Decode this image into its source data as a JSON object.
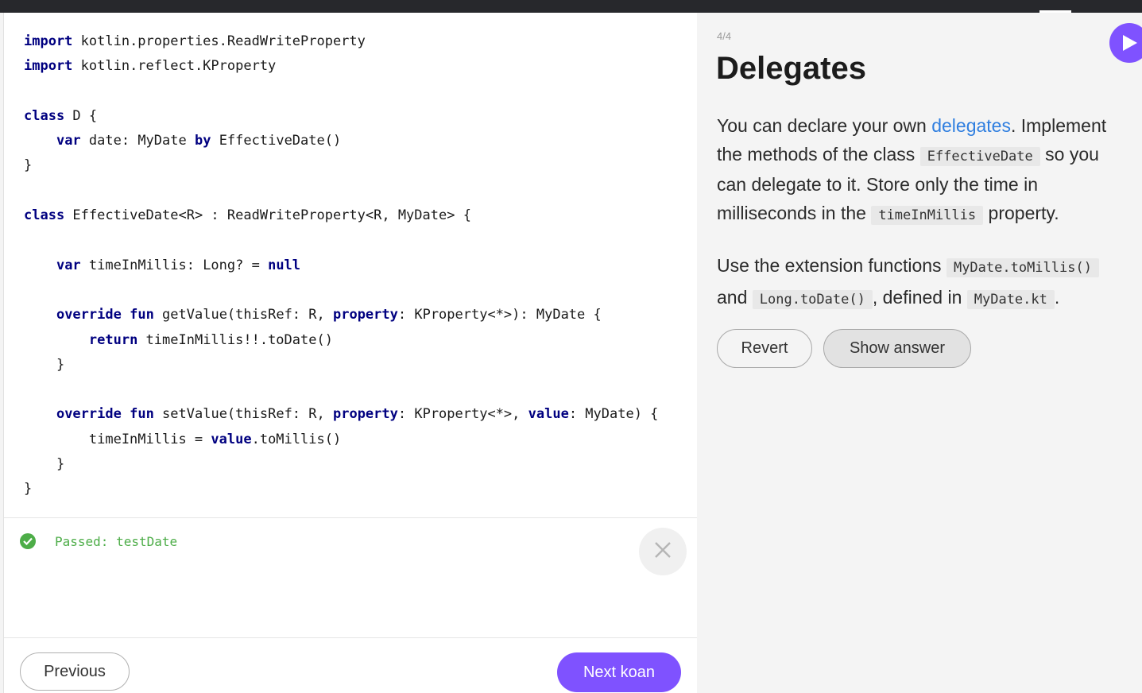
{
  "editor": {
    "code_lines": [
      [
        {
          "t": "import",
          "k": true
        },
        {
          "t": " kotlin.properties.ReadWriteProperty"
        }
      ],
      [
        {
          "t": "import",
          "k": true
        },
        {
          "t": " kotlin.reflect.KProperty"
        }
      ],
      [],
      [
        {
          "t": "class",
          "k": true
        },
        {
          "t": " D {"
        }
      ],
      [
        {
          "t": "    "
        },
        {
          "t": "var",
          "k": true
        },
        {
          "t": " date: MyDate "
        },
        {
          "t": "by",
          "k": true
        },
        {
          "t": " EffectiveDate()"
        }
      ],
      [
        {
          "t": "}"
        }
      ],
      [],
      [
        {
          "t": "class",
          "k": true
        },
        {
          "t": " EffectiveDate<R> : ReadWriteProperty<R, MyDate> {"
        }
      ],
      [],
      [
        {
          "t": "    "
        },
        {
          "t": "var",
          "k": true
        },
        {
          "t": " timeInMillis: Long? = "
        },
        {
          "t": "null",
          "k": true
        }
      ],
      [],
      [
        {
          "t": "    "
        },
        {
          "t": "override",
          "k": true
        },
        {
          "t": " "
        },
        {
          "t": "fun",
          "k": true
        },
        {
          "t": " getValue(thisRef: R, "
        },
        {
          "t": "property",
          "k": true
        },
        {
          "t": ": KProperty<*>): MyDate {"
        }
      ],
      [
        {
          "t": "        "
        },
        {
          "t": "return",
          "k": true
        },
        {
          "t": " timeInMillis!!.toDate()"
        }
      ],
      [
        {
          "t": "    }"
        }
      ],
      [],
      [
        {
          "t": "    "
        },
        {
          "t": "override",
          "k": true
        },
        {
          "t": " "
        },
        {
          "t": "fun",
          "k": true
        },
        {
          "t": " setValue(thisRef: R, "
        },
        {
          "t": "property",
          "k": true
        },
        {
          "t": ": KProperty<*>, "
        },
        {
          "t": "value",
          "k": true
        },
        {
          "t": ": MyDate) {"
        }
      ],
      [
        {
          "t": "        timeInMillis = "
        },
        {
          "t": "value",
          "k": true
        },
        {
          "t": ".toMillis()"
        }
      ],
      [
        {
          "t": "    }"
        }
      ],
      [
        {
          "t": "}"
        }
      ]
    ]
  },
  "result": {
    "status_text": "Passed: testDate",
    "status_icon": "check-circle-icon",
    "status_color": "#4dad48",
    "close_icon": "close-icon"
  },
  "nav": {
    "previous_label": "Previous",
    "next_label": "Next koan"
  },
  "task": {
    "progress": "4/4",
    "title": "Delegates",
    "p1": {
      "t1": "You can declare your own ",
      "link": "delegates",
      "t2": ". Implement the methods of the class ",
      "c1": "EffectiveDate",
      "t3": " so you can delegate to it. Store only the time in milliseconds in the ",
      "c2": "timeInMillis",
      "t4": " property."
    },
    "p2": {
      "t1": "Use the extension functions ",
      "c1": "MyDate.toMillis()",
      "t2": " and ",
      "c2": "Long.toDate()",
      "t3": ", defined in ",
      "c3": "MyDate.kt",
      "t4": "."
    },
    "revert_label": "Revert",
    "show_answer_label": "Show answer",
    "run_icon": "play-icon"
  },
  "colors": {
    "accent": "#7f52ff",
    "link": "#307fe0",
    "keyword": "#000080",
    "success": "#4dad48"
  }
}
